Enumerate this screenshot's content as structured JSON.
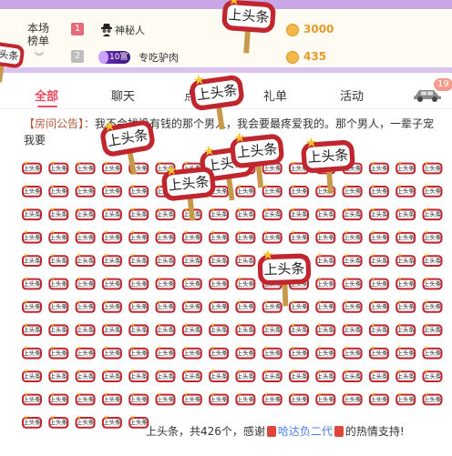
{
  "rank": {
    "title_line1": "本场",
    "title_line2": "榜单",
    "rows": [
      {
        "rank": "1",
        "name": "神秘人",
        "coins": "3000"
      },
      {
        "rank": "2",
        "badge": "10富",
        "name": "专吃驴肉",
        "coins": "435"
      }
    ]
  },
  "tabs": [
    "全部",
    "聊天",
    "点",
    "礼单",
    "活动"
  ],
  "tab_badge": "19",
  "announcement": {
    "prefix": "【房间公告】：",
    "text": "我不会找没有钱的那个男人，我会要最疼爱我的。那个男人，一辈子宠我要"
  },
  "gift_name": "上头条",
  "gift_message": {
    "lead": "上头条，共426个，感谢",
    "user": "哈达负二代",
    "tail": "的热情支持!"
  },
  "colors": {
    "accent": "#e84a5f",
    "coin": "#e79a2a",
    "sticker_frame": "#c0262e",
    "sticker_star": "#f6c531",
    "sticker_pole": "#c69a4a"
  },
  "icons": [
    "incognito-icon",
    "coin-icon",
    "car-icon",
    "star-icon"
  ]
}
